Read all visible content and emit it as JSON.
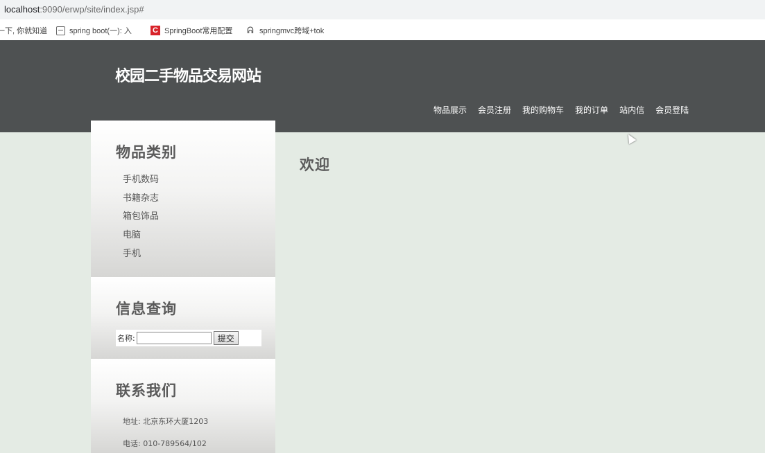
{
  "browser": {
    "url_host": "localhost",
    "url_rest": ":9090/erwp/site/index.jsp#",
    "bookmarks": [
      {
        "label": "一下, 你就知道",
        "icon": "none"
      },
      {
        "label": "spring boot(一): 入",
        "icon": "page-icon"
      },
      {
        "label": "SpringBoot常用配置",
        "icon": "csdn-icon",
        "icon_color": "#d8232a"
      },
      {
        "label": "springmvc跨域+tok",
        "icon": "leaf-icon"
      }
    ]
  },
  "site": {
    "title": "校园二手物品交易网站",
    "header_color": "#4e5152",
    "background_color": "#e4ebe4",
    "nav": [
      "物品展示",
      "会员注册",
      "我的购物车",
      "我的订单",
      "站内信",
      "会员登陆"
    ]
  },
  "sidebar": {
    "categories": {
      "title": "物品类别",
      "items": [
        "手机数码",
        "书籍杂志",
        "箱包饰品",
        "电脑",
        "手机"
      ]
    },
    "search": {
      "title": "信息查询",
      "name_label": "名称:",
      "input_value": "",
      "submit_label": "提交"
    },
    "contact": {
      "title": "联系我们",
      "address": "地址: 北京东环大厦1203",
      "phone": "电话: 010-789564/102"
    }
  },
  "main": {
    "heading": "欢迎"
  }
}
